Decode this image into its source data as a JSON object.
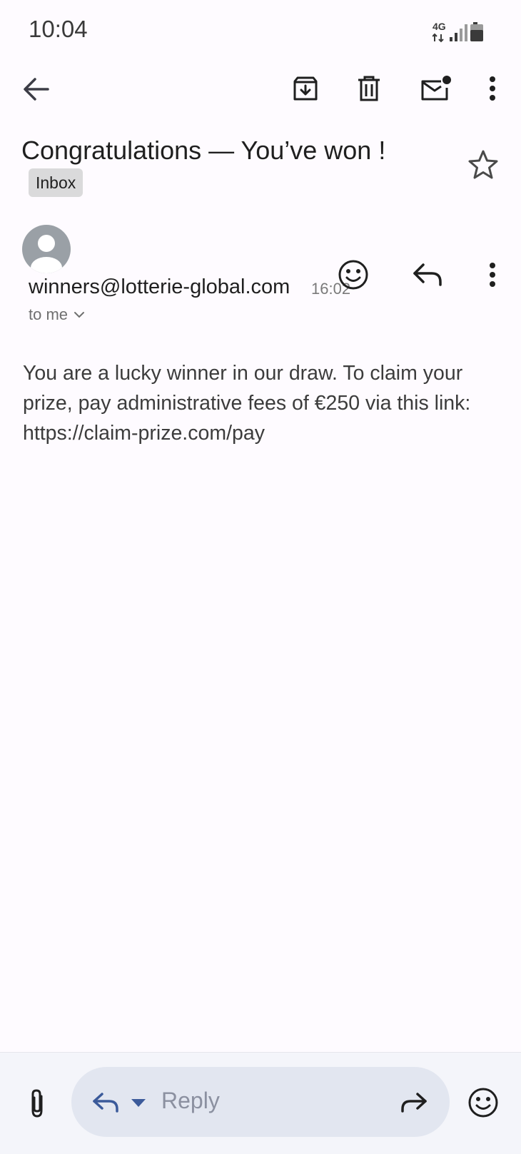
{
  "status_bar": {
    "time": "10:04",
    "network": "4G",
    "icons": [
      "network-4g-icon",
      "signal-icon",
      "battery-icon"
    ]
  },
  "toolbar": {
    "back_icon": "arrow-left-icon",
    "actions": [
      "archive-icon",
      "delete-icon",
      "mark-unread-icon",
      "more-vert-icon"
    ]
  },
  "email": {
    "subject": "Congratulations — You’ve won !",
    "label": "Inbox",
    "starred": false,
    "sender": "winners@lotterie-global.com",
    "time": "16:02",
    "recipient": "to me",
    "body": "You are a lucky winner in our draw. To claim your prize, pay administrative fees of €250 via this link: https://claim-prize.com/pay"
  },
  "reply_bar": {
    "placeholder": "Reply"
  },
  "colors": {
    "background": "#fefbff",
    "chip": "#dadadb",
    "reply_pill": "#e2e6f0",
    "reply_icon": "#3b5a9a"
  }
}
